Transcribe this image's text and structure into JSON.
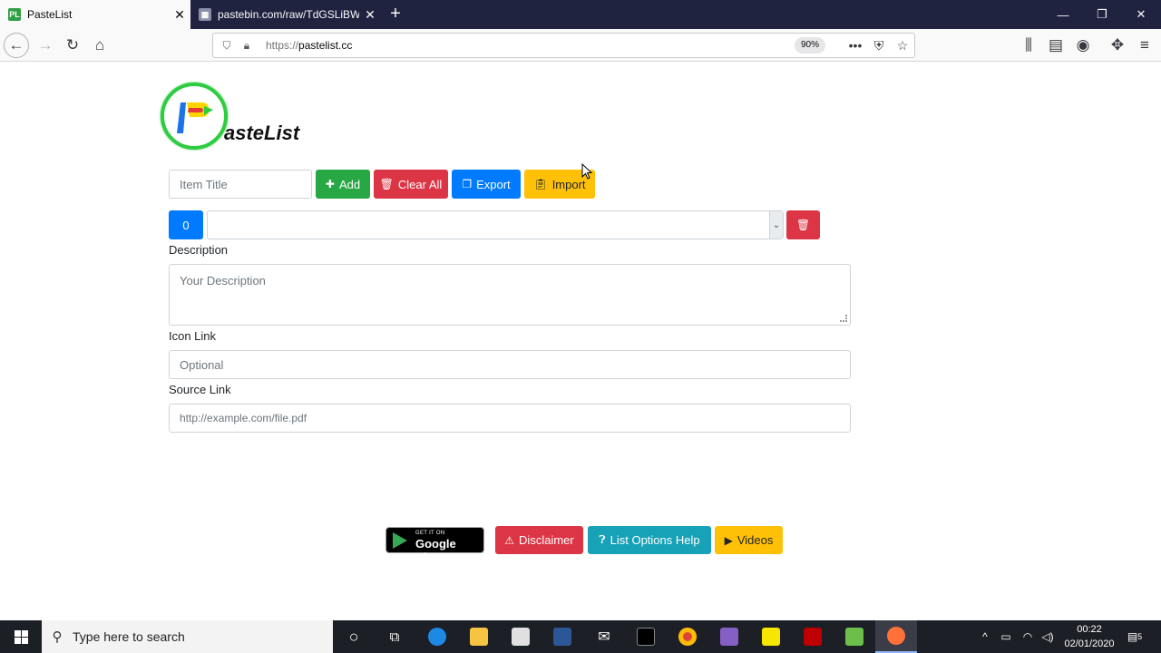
{
  "browser": {
    "tabs": [
      {
        "title": "PasteList",
        "favicon": "pl"
      },
      {
        "title": "pastebin.com/raw/TdGSLiBW",
        "favicon": "page"
      }
    ],
    "tab_close": "✕",
    "new_tab": "+",
    "url_protocol": "https://",
    "url_host": "pastelist.cc",
    "zoom": "90%"
  },
  "page": {
    "logo_text": "asteList",
    "logo_letter": "P",
    "item_title_placeholder": "Item Title",
    "buttons": {
      "add": "Add",
      "clear_all": "Clear All",
      "export": "Export",
      "import": "Import"
    },
    "item_count": "0",
    "description_label": "Description",
    "description_placeholder": "Your Description",
    "icon_link_label": "Icon Link",
    "icon_link_placeholder": "Optional",
    "source_link_label": "Source Link",
    "source_link_placeholder": "http://example.com/file.pdf",
    "footer": {
      "google_play_small": "GET IT ON",
      "google_play_big": "Google Play",
      "disclaimer": "Disclaimer",
      "list_options_help": "List Options Help",
      "videos": "Videos"
    }
  },
  "taskbar": {
    "search_placeholder": "Type here to search",
    "time": "00:22",
    "date": "02/01/2020",
    "notification_count": "5"
  },
  "colors": {
    "green": "#28a745",
    "red": "#dc3545",
    "blue": "#007bff",
    "yellow": "#ffc107",
    "teal": "#17a2b8"
  }
}
